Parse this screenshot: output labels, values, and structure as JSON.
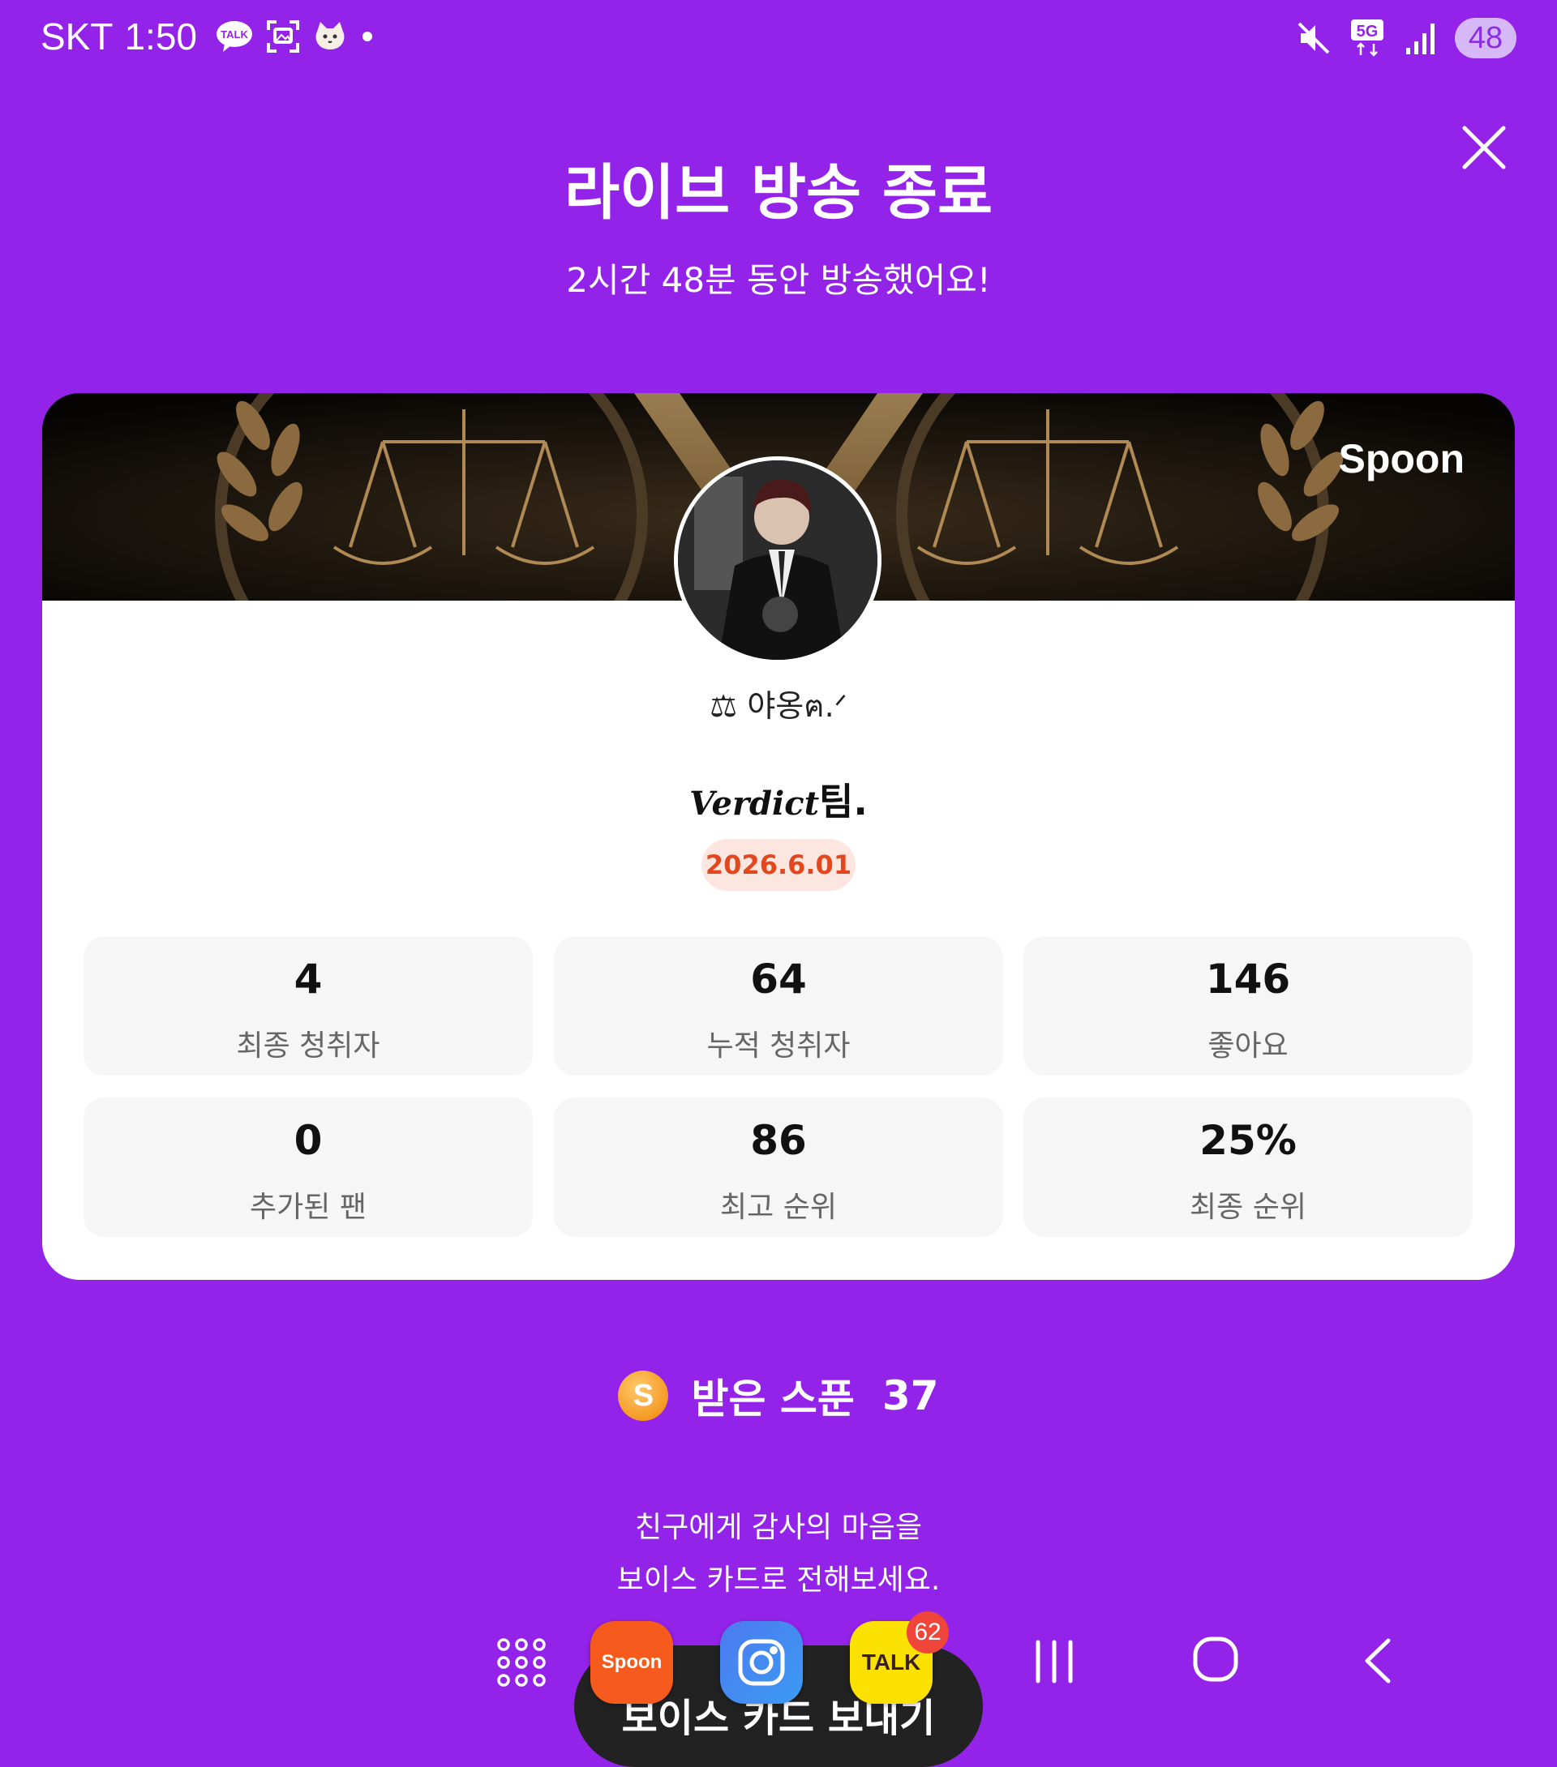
{
  "status_bar": {
    "carrier": "SKT",
    "time": "1:50",
    "talk_icon_label": "TALK",
    "network": "5G",
    "battery": "48"
  },
  "header": {
    "title": "라이브 방송 종료",
    "subtitle": "2시간 48분 동안 방송했어요!"
  },
  "card": {
    "banner_logo": "Spoon",
    "dj_name": "⚖ 야옹ฅ.ᐟ",
    "room_title_script": "Verdict",
    "room_title_suffix": "팀.",
    "date": "2026.6.01",
    "stats": [
      {
        "value": "4",
        "label": "최종 청취자"
      },
      {
        "value": "64",
        "label": "누적 청취자"
      },
      {
        "value": "146",
        "label": "좋아요"
      },
      {
        "value": "0",
        "label": "추가된 팬"
      },
      {
        "value": "86",
        "label": "최고 순위"
      },
      {
        "value": "25%",
        "label": "최종 순위"
      }
    ]
  },
  "spoons": {
    "coin_letter": "S",
    "label": "받은 스푼",
    "count": "37"
  },
  "message": {
    "line1": "친구에게 감사의 마음을",
    "line2": "보이스 카드로 전해보세요."
  },
  "voice_card_button": "보이스 카드 보내기",
  "taskbar": {
    "spoon_app_label": "Spoon",
    "talk_app_label": "TALK",
    "talk_badge": "62"
  },
  "colors": {
    "background": "#9323E8",
    "date_text": "#E3471D",
    "date_pill": "#FDE6E0",
    "stat_bg": "#F6F6F6"
  }
}
